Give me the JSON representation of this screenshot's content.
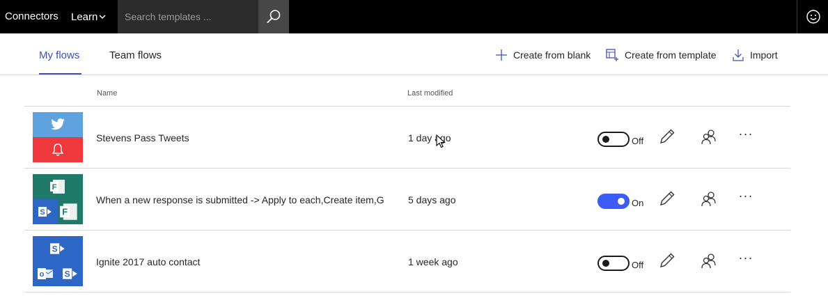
{
  "topbar": {
    "connectors_label": "Connectors",
    "learn_label": "Learn",
    "search_placeholder": "Search templates ...",
    "icons": [
      "search-icon",
      "smiley-icon",
      "chevron-down-icon"
    ]
  },
  "tabs": [
    {
      "label": "My flows",
      "active": true
    },
    {
      "label": "Team flows",
      "active": false
    }
  ],
  "actions": {
    "create_blank": "Create from blank",
    "create_template": "Create from template",
    "import": "Import"
  },
  "table": {
    "columns": {
      "name": "Name",
      "last_modified": "Last modified"
    },
    "rows": [
      {
        "name": "Stevens Pass Tweets",
        "modified": "1 day ago",
        "toggle": "Off",
        "icons": [
          "twitter-icon",
          "notification-bell-icon"
        ]
      },
      {
        "name": "When a new response is submitted -> Apply to each,Create item,Ge",
        "modified": "5 days ago",
        "toggle": "On",
        "icons": [
          "forms-icon",
          "sharepoint-icon"
        ]
      },
      {
        "name": "Ignite 2017 auto contact",
        "modified": "1 week ago",
        "toggle": "Off",
        "icons": [
          "sharepoint-icon",
          "outlook-icon"
        ]
      }
    ]
  },
  "colors": {
    "accent": "#3f51b5",
    "toggle_on": "#3c5cf5",
    "twitter": "#5ea3e0",
    "notification": "#f0393d",
    "forms": "#1f7a6a",
    "sharepoint": "#2d66c5"
  }
}
